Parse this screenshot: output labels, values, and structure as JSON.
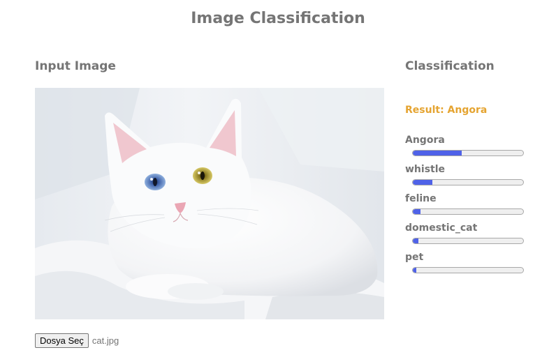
{
  "page": {
    "title": "Image Classification"
  },
  "input": {
    "heading": "Input Image",
    "image_subject": "white angora cat with heterochromatic eyes (blue and yellow) lying on white sheets",
    "choose_file_label": "Dosya Seç",
    "file_name": "cat.jpg"
  },
  "classification": {
    "heading": "Classification",
    "result_text": "Result: Angora",
    "result_color": "#e5a431",
    "bar_color": "#4f62e8",
    "scores": [
      {
        "label": "Angora",
        "value": 0.44
      },
      {
        "label": "whistle",
        "value": 0.18
      },
      {
        "label": "feline",
        "value": 0.07
      },
      {
        "label": "domestic_cat",
        "value": 0.05
      },
      {
        "label": "pet",
        "value": 0.03
      }
    ]
  }
}
